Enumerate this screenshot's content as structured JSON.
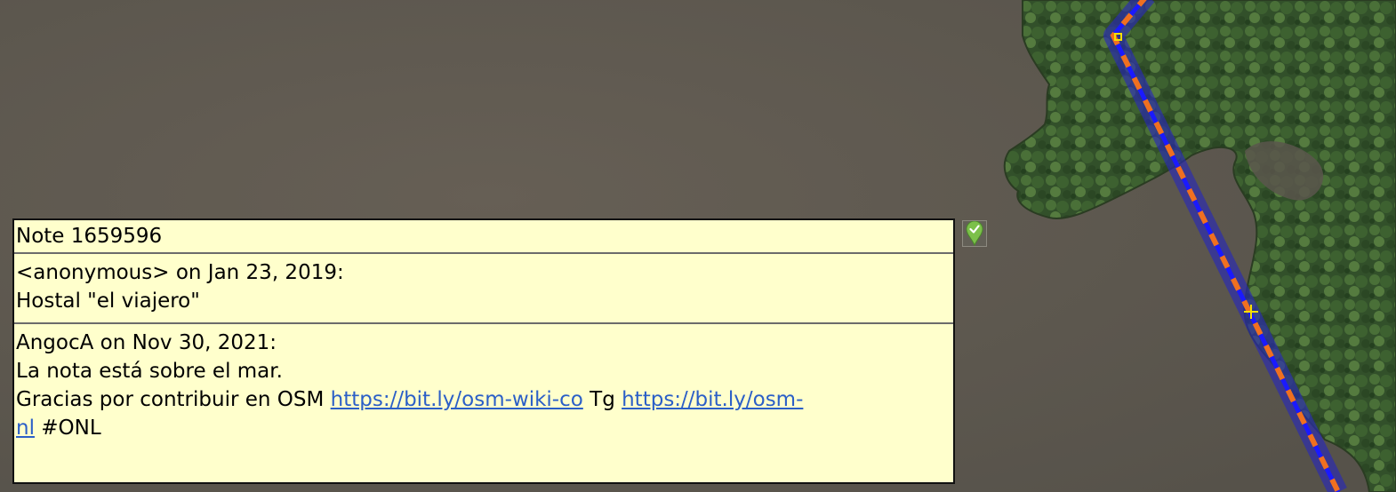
{
  "note": {
    "title": "Note 1659596",
    "comments": [
      {
        "header": "<anonymous> on Jan 23, 2019:",
        "text": "Hostal \"el viajero\""
      },
      {
        "header": "AngocA on Nov 30, 2021:",
        "text": "La nota está sobre el mar.",
        "text2_prefix": "Gracias por contribuir en OSM ",
        "link1": "https://bit.ly/osm-wiki-co",
        "between": " Tg ",
        "link2_part1": "https://bit.ly/osm-",
        "link2_part2": "nl",
        "suffix": " #ONL"
      }
    ]
  },
  "marker": {
    "icon": "note-closed-marker-icon",
    "color": "#7cc04a"
  },
  "map": {
    "water_color": "#5f5a50",
    "forest_color": "#3a5a2a",
    "way_highlight_color": "#2a2ab5",
    "way_dash_color": "#f07020",
    "way_inner_dash_color": "#1a1aff",
    "node_color": "#f5e000"
  }
}
